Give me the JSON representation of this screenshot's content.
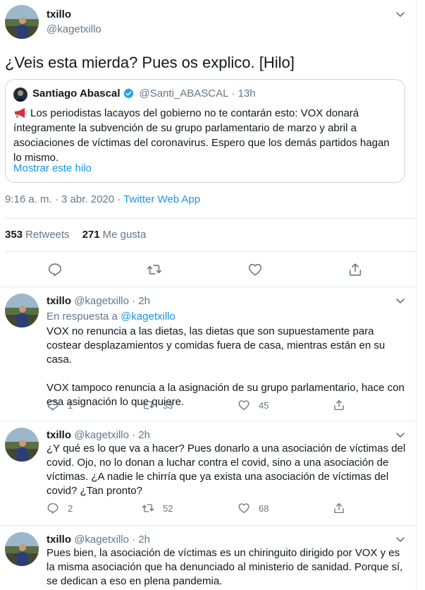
{
  "main_tweet": {
    "name": "txillo",
    "handle": "@kagetxillo",
    "text": "¿Veis esta mierda? Pues os explico. [Hilo]",
    "quoted": {
      "name": "Santiago Abascal",
      "handle": "@Santi_ABASCAL",
      "time": "· 13h",
      "text": "Los periodistas lacayos del gobierno no te contarán esto: VOX donará íntegramente la subvención de su grupo parlamentario de marzo y abril a asociaciones de víctimas del coronavirus. Espero que los demás partidos hagan lo mismo.",
      "show_thread": "Mostrar este hilo"
    },
    "timestamp": "9:16 a. m. · 3 abr. 2020 ·",
    "source": "Twitter Web App",
    "retweets_count": "353",
    "retweets_label": "Retweets",
    "likes_count": "271",
    "likes_label": "Me gusta",
    "actions": [
      "reply-icon",
      "retweet-icon",
      "like-icon",
      "share-icon"
    ]
  },
  "replies": [
    {
      "name": "txillo",
      "handle": "@kagetxillo",
      "time": "· 2h",
      "in_reply_label": "En respuesta a",
      "in_reply_mention": "@kagetxillo",
      "paragraphs": [
        "VOX no renuncia a las dietas, las dietas que son supuestamente para costear desplazamientos y comidas fuera de casa, mientras están en su casa.",
        "VOX tampoco renuncia a la asignación de su grupo parlamentario, hace con esa asignación lo que quiere."
      ],
      "reply_count": "1",
      "retweet_count": "33",
      "like_count": "45"
    },
    {
      "name": "txillo",
      "handle": "@kagetxillo",
      "time": "· 2h",
      "paragraphs": [
        "¿Y qué es lo que va a hacer? Pues donarlo a una asociación de víctimas del covid. Ojo, no lo donan a luchar contra el covid, sino a una asociación de víctimas. ¿A nadie le chirría que ya exista una asociación de víctimas del covid? ¿Tan pronto?"
      ],
      "reply_count": "2",
      "retweet_count": "52",
      "like_count": "68"
    },
    {
      "name": "txillo",
      "handle": "@kagetxillo",
      "time": "· 2h",
      "paragraphs": [
        "Pues bien, la asociación de víctimas es un chiringuito dirigido por VOX y es la misma asociación que ha denunciado al ministerio de sanidad. Porque sí, se dedican a eso en plena pandemia."
      ]
    }
  ],
  "colors": {
    "accent": "#1b95e0",
    "secondary_text": "#657786",
    "border": "#e6ecf0",
    "verified": "#1da1f2"
  }
}
